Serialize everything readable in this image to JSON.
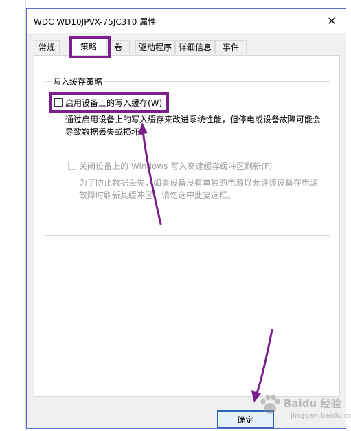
{
  "window": {
    "title": "WDC WD10JPVX-75JC3T0 属性",
    "close_glyph": "✕"
  },
  "tabs": [
    {
      "label": "常规"
    },
    {
      "label": "策略"
    },
    {
      "label": "卷"
    },
    {
      "label": "驱动程序"
    },
    {
      "label": "详细信息"
    },
    {
      "label": "事件"
    }
  ],
  "policy": {
    "group_title": "写入缓存策略",
    "option1": {
      "label": "启用设备上的写入缓存(W)",
      "checked": false,
      "description_line1": "通过启用设备上的写入缓存来改进系统性能，但停电或设备故障可能会",
      "description_line2": "导致数据丢失或损坏。"
    },
    "option2": {
      "label": "关闭设备上的 Windows 写入高速缓存缓冲区刷新(F)",
      "checked": false,
      "enabled": false,
      "description_line1": "为了防止数据丢失，如果设备没有单独的电源以允许该设备在电源",
      "description_line2": "故障时刷新其缓冲区，请勿选中此复选框。"
    }
  },
  "buttons": {
    "ok": "确定"
  },
  "watermark": {
    "text": "Baidu 经验",
    "sub": "jingyan.baidu.com"
  },
  "colors": {
    "highlight": "#7b1f8e",
    "button_border": "#2a63b8",
    "button_bg": "#e5f1fb",
    "dialog_border": "#5b6bd1"
  }
}
